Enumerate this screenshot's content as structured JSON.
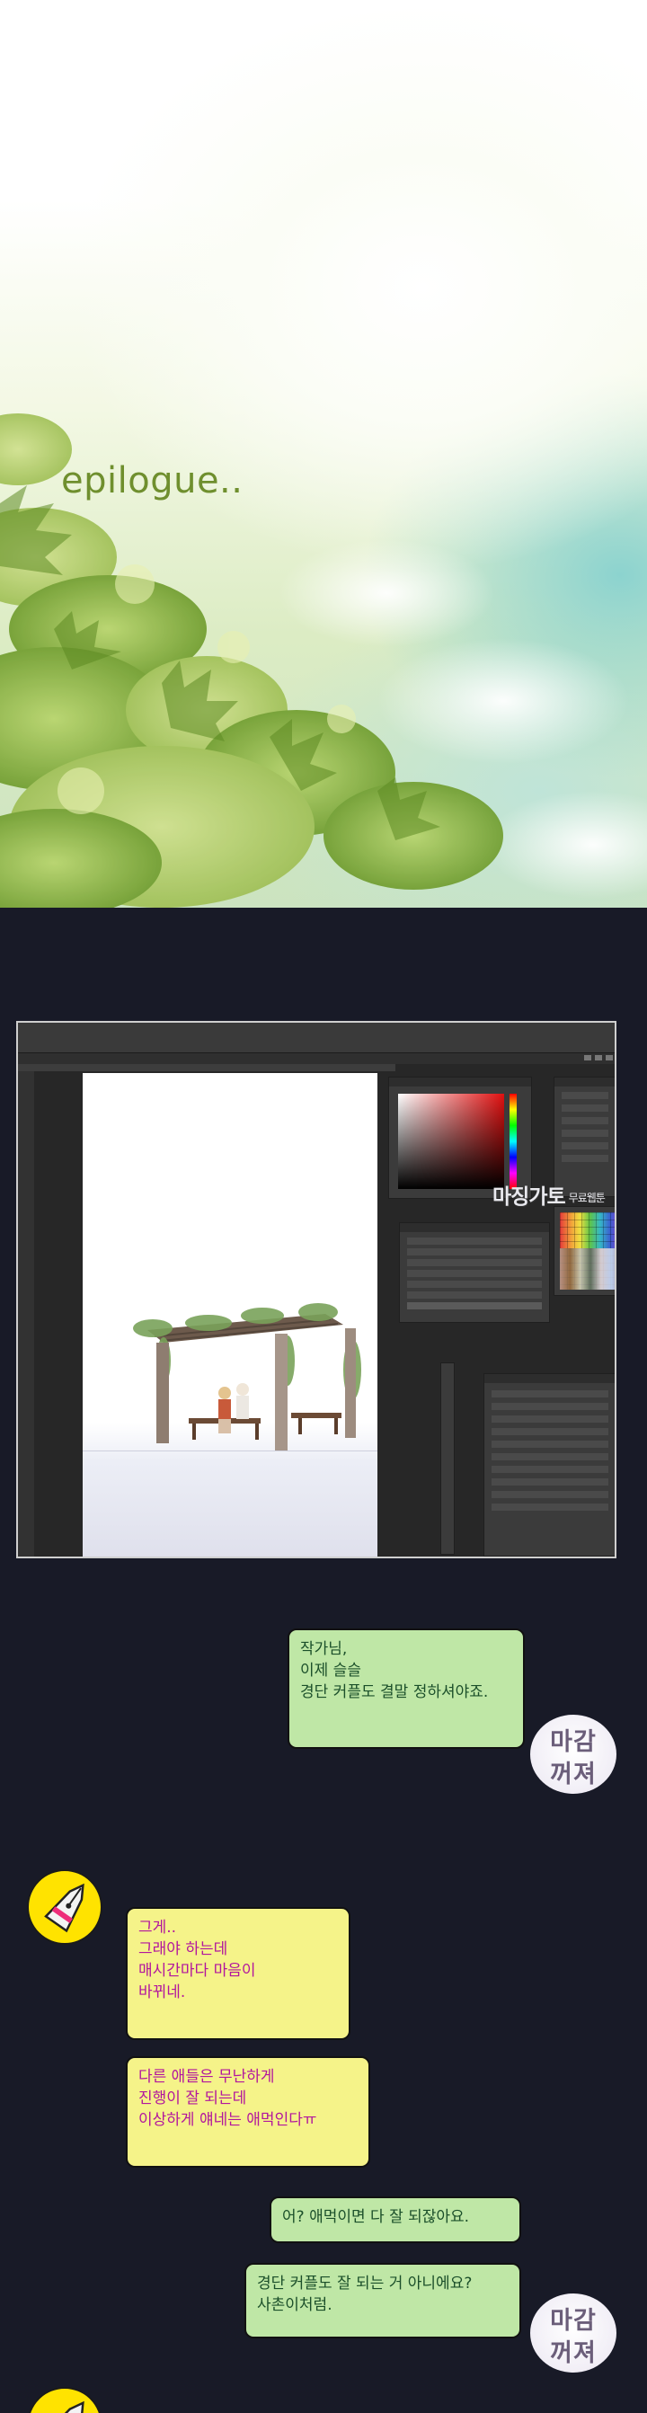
{
  "epilogue": {
    "title": "epilogue.."
  },
  "screenshot": {
    "watermark": {
      "main": "마징가토",
      "sub": "무료웹툰"
    },
    "colors": {
      "bg": "#272727",
      "panel": "#3b3b3b"
    }
  },
  "chat": [
    {
      "side": "right",
      "text": "작가님,\n이제 슬슬\n경단 커플도 결말 정하셔야죠."
    },
    {
      "side": "left",
      "text": "그게..\n그래야 하는데\n매시간마다 마음이\n바뀌네."
    },
    {
      "side": "left",
      "text": "다른 애들은 무난하게\n진행이 잘 되는데\n이상하게 얘네는 애먹인다ㅠ"
    },
    {
      "side": "right",
      "text": "어? 애먹이면 다 잘 되잖아요."
    },
    {
      "side": "right",
      "text": "경단 커플도 잘 되는 거 아니에요?\n사촌이처럼."
    }
  ],
  "avatars": {
    "editor": {
      "line1": "마감",
      "line2": "꺼져"
    },
    "author": {
      "icon": "pen-nib-icon"
    }
  },
  "colors": {
    "page_bg": "#181a27",
    "right_bubble": "#bfe7a6",
    "right_text": "#1b4f2a",
    "left_bubble": "#f5f389",
    "left_text": "#b2169e",
    "author_avatar": "#ffe300",
    "title_green": "#6f8f2e"
  }
}
